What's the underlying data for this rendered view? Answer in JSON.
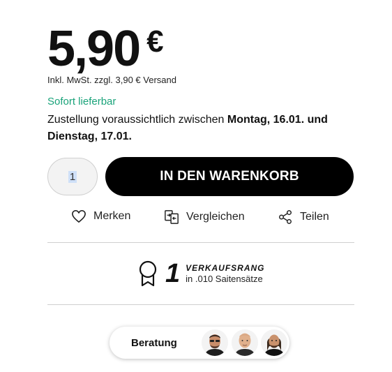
{
  "price": {
    "value": "5,90",
    "currency": "€"
  },
  "tax_note": "Inkl. MwSt. zzgl. 3,90 € Versand",
  "availability": "Sofort lieferbar",
  "delivery": {
    "prefix": "Zustellung voraussichtlich zwischen ",
    "date_from": "Montag, 16.01.",
    "connector": " und ",
    "date_to": "Dienstag, 17.01."
  },
  "quantity": "1",
  "cart_button": "IN DEN WARENKORB",
  "actions": {
    "remember": "Merken",
    "compare": "Vergleichen",
    "share": "Teilen"
  },
  "rank": {
    "number": "1",
    "label": "VERKAUFSRANG",
    "sub": "in .010 Saitensätze"
  },
  "advice": {
    "label": "Beratung"
  },
  "colors": {
    "accent_green": "#1aa37a",
    "button_black": "#000000"
  },
  "icons": [
    "heart-icon",
    "compare-icon",
    "share-icon",
    "award-icon"
  ]
}
